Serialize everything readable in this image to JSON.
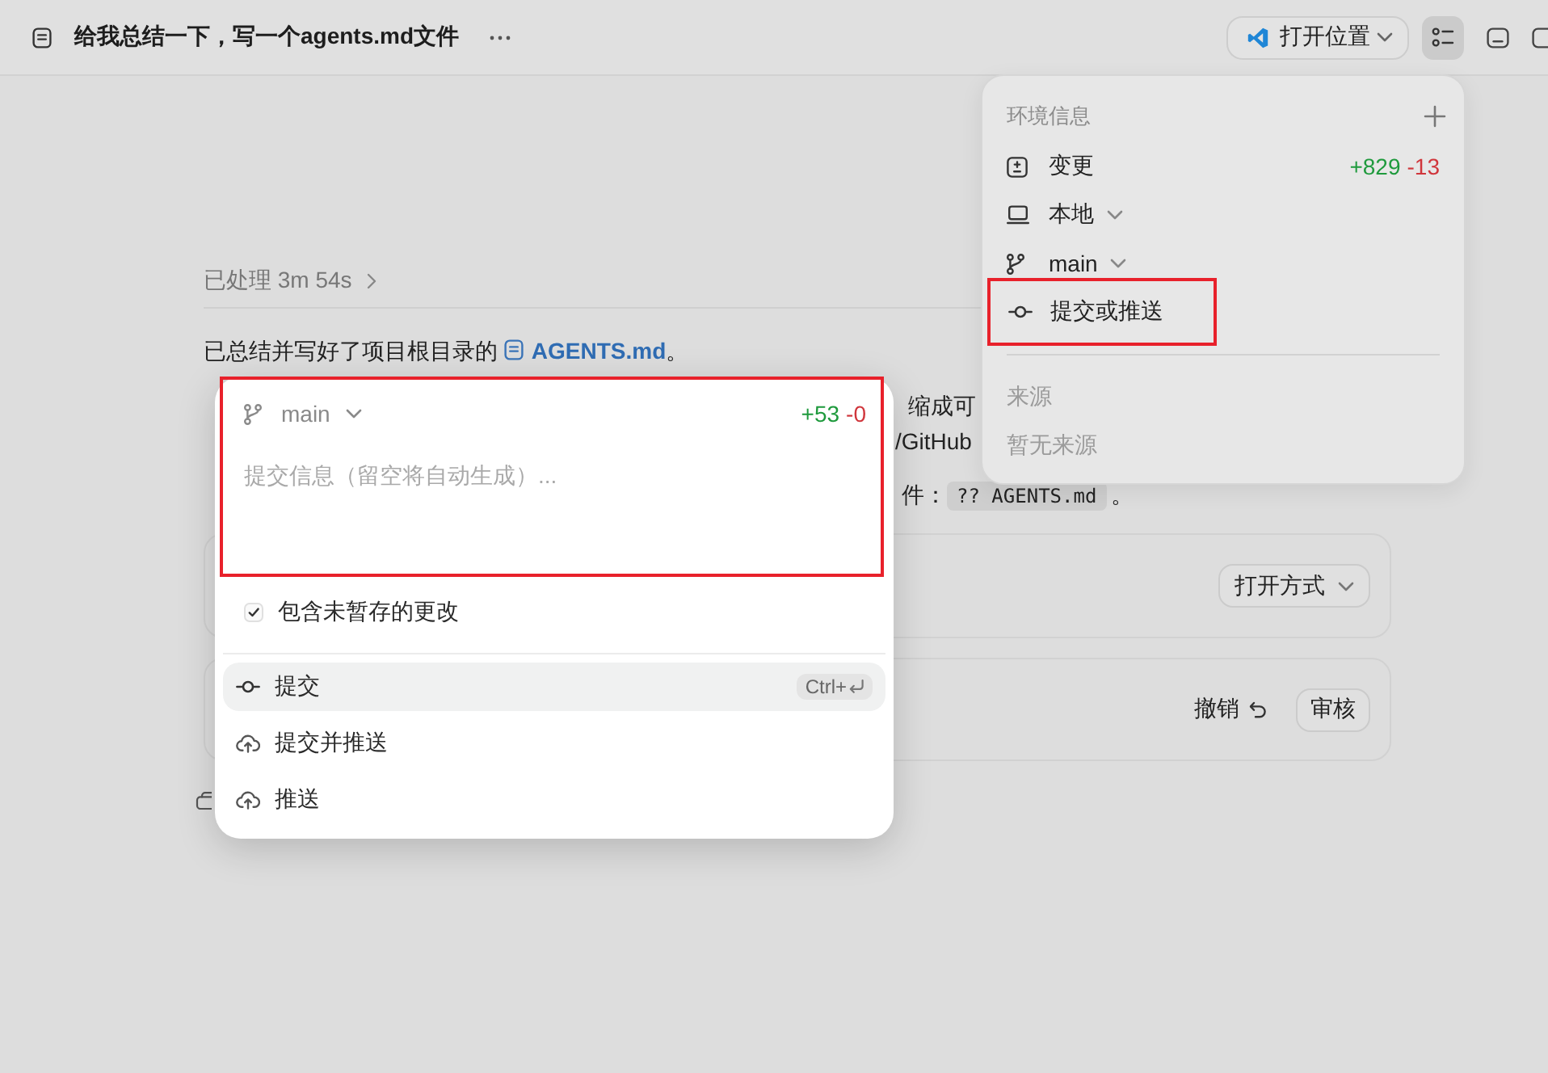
{
  "header": {
    "title": "给我总结一下，写一个agents.md文件",
    "open_button": "打开位置",
    "toolbar": [
      {
        "kind": "list",
        "selected": true
      },
      {
        "kind": "panel",
        "selected": false
      },
      {
        "kind": "window",
        "selected": false
      }
    ]
  },
  "thread": {
    "processed": "已处理 3m 54s",
    "summary": {
      "text": "已总结并写好了项目根目录的",
      "file": "AGENTS.md",
      "end": "。"
    },
    "paragraph_lines": [
      {
        "text": "缩成可"
      },
      {
        "text": "/GitHub"
      },
      {
        "text": "件：",
        "code": "?? AGENTS.md",
        "end": "。"
      }
    ],
    "cards": [
      {
        "kind": "open_with",
        "button": "打开方式"
      },
      {
        "kind": "review",
        "undo": "撤销",
        "button": "审核"
      }
    ]
  },
  "environment": {
    "title": "环境信息",
    "items": [
      {
        "kind": "changes",
        "label": "变更",
        "added": "+829",
        "removed": "-13",
        "dropdown": false,
        "highlighted": false
      },
      {
        "kind": "local",
        "label": "本地",
        "dropdown": true,
        "highlighted": false
      },
      {
        "kind": "branch",
        "label": "main",
        "dropdown": true,
        "highlighted": false
      },
      {
        "kind": "commit",
        "label": "提交或推送",
        "dropdown": false,
        "highlighted": true
      }
    ],
    "section": "来源",
    "empty": "暂无来源"
  },
  "commit": {
    "highlighted": true,
    "branch": "main",
    "added": "+53",
    "removed": "-0",
    "message": {
      "placeholder": "提交信息（留空将自动生成）..."
    },
    "include_unstaged": {
      "label": "包含未暂存的更改",
      "checked": true
    },
    "actions": [
      {
        "kind": "commit",
        "label": "提交",
        "selected": true,
        "shortcut": "Ctrl+"
      },
      {
        "kind": "commit_push",
        "label": "提交并推送",
        "selected": false
      },
      {
        "kind": "push",
        "label": "推送",
        "selected": false
      }
    ]
  }
}
